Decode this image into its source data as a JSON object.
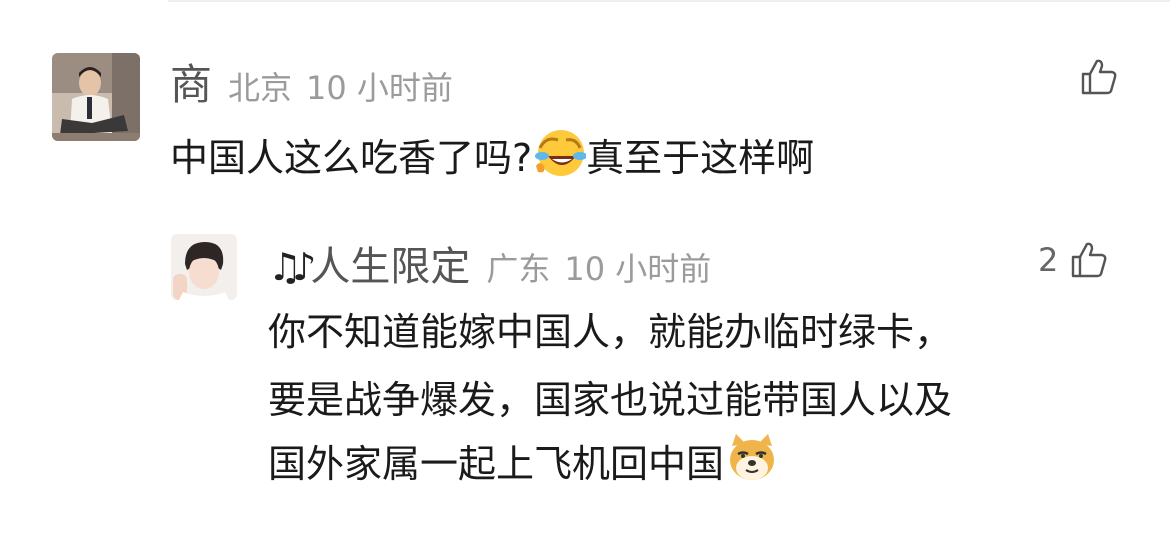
{
  "comments": [
    {
      "username": "商",
      "location": "北京",
      "time": "10 小时前",
      "text": "中国人这么吃香了吗?",
      "text_after_emoji": "真至于这样啊",
      "emoji": "crying-laughing-emoji",
      "like_count": ""
    }
  ],
  "reply": {
    "username": "人生限定",
    "prefix_icon": "music-notes-icon",
    "location": "广东",
    "time": "10 小时前",
    "like_count": "2",
    "lines": [
      "你不知道能嫁中国人，就能办临时绿卡，",
      "要是战争爆发，国家也说过能带国人以及",
      "国外家属一起上飞机回中国"
    ],
    "emoji": "doge-emoji"
  },
  "colors": {
    "text_primary": "#1a1a1a",
    "text_username": "#555555",
    "text_meta": "#9b9b9b",
    "emoji_yellow": "#ffc93c",
    "doge_orange": "#f0b54a"
  }
}
